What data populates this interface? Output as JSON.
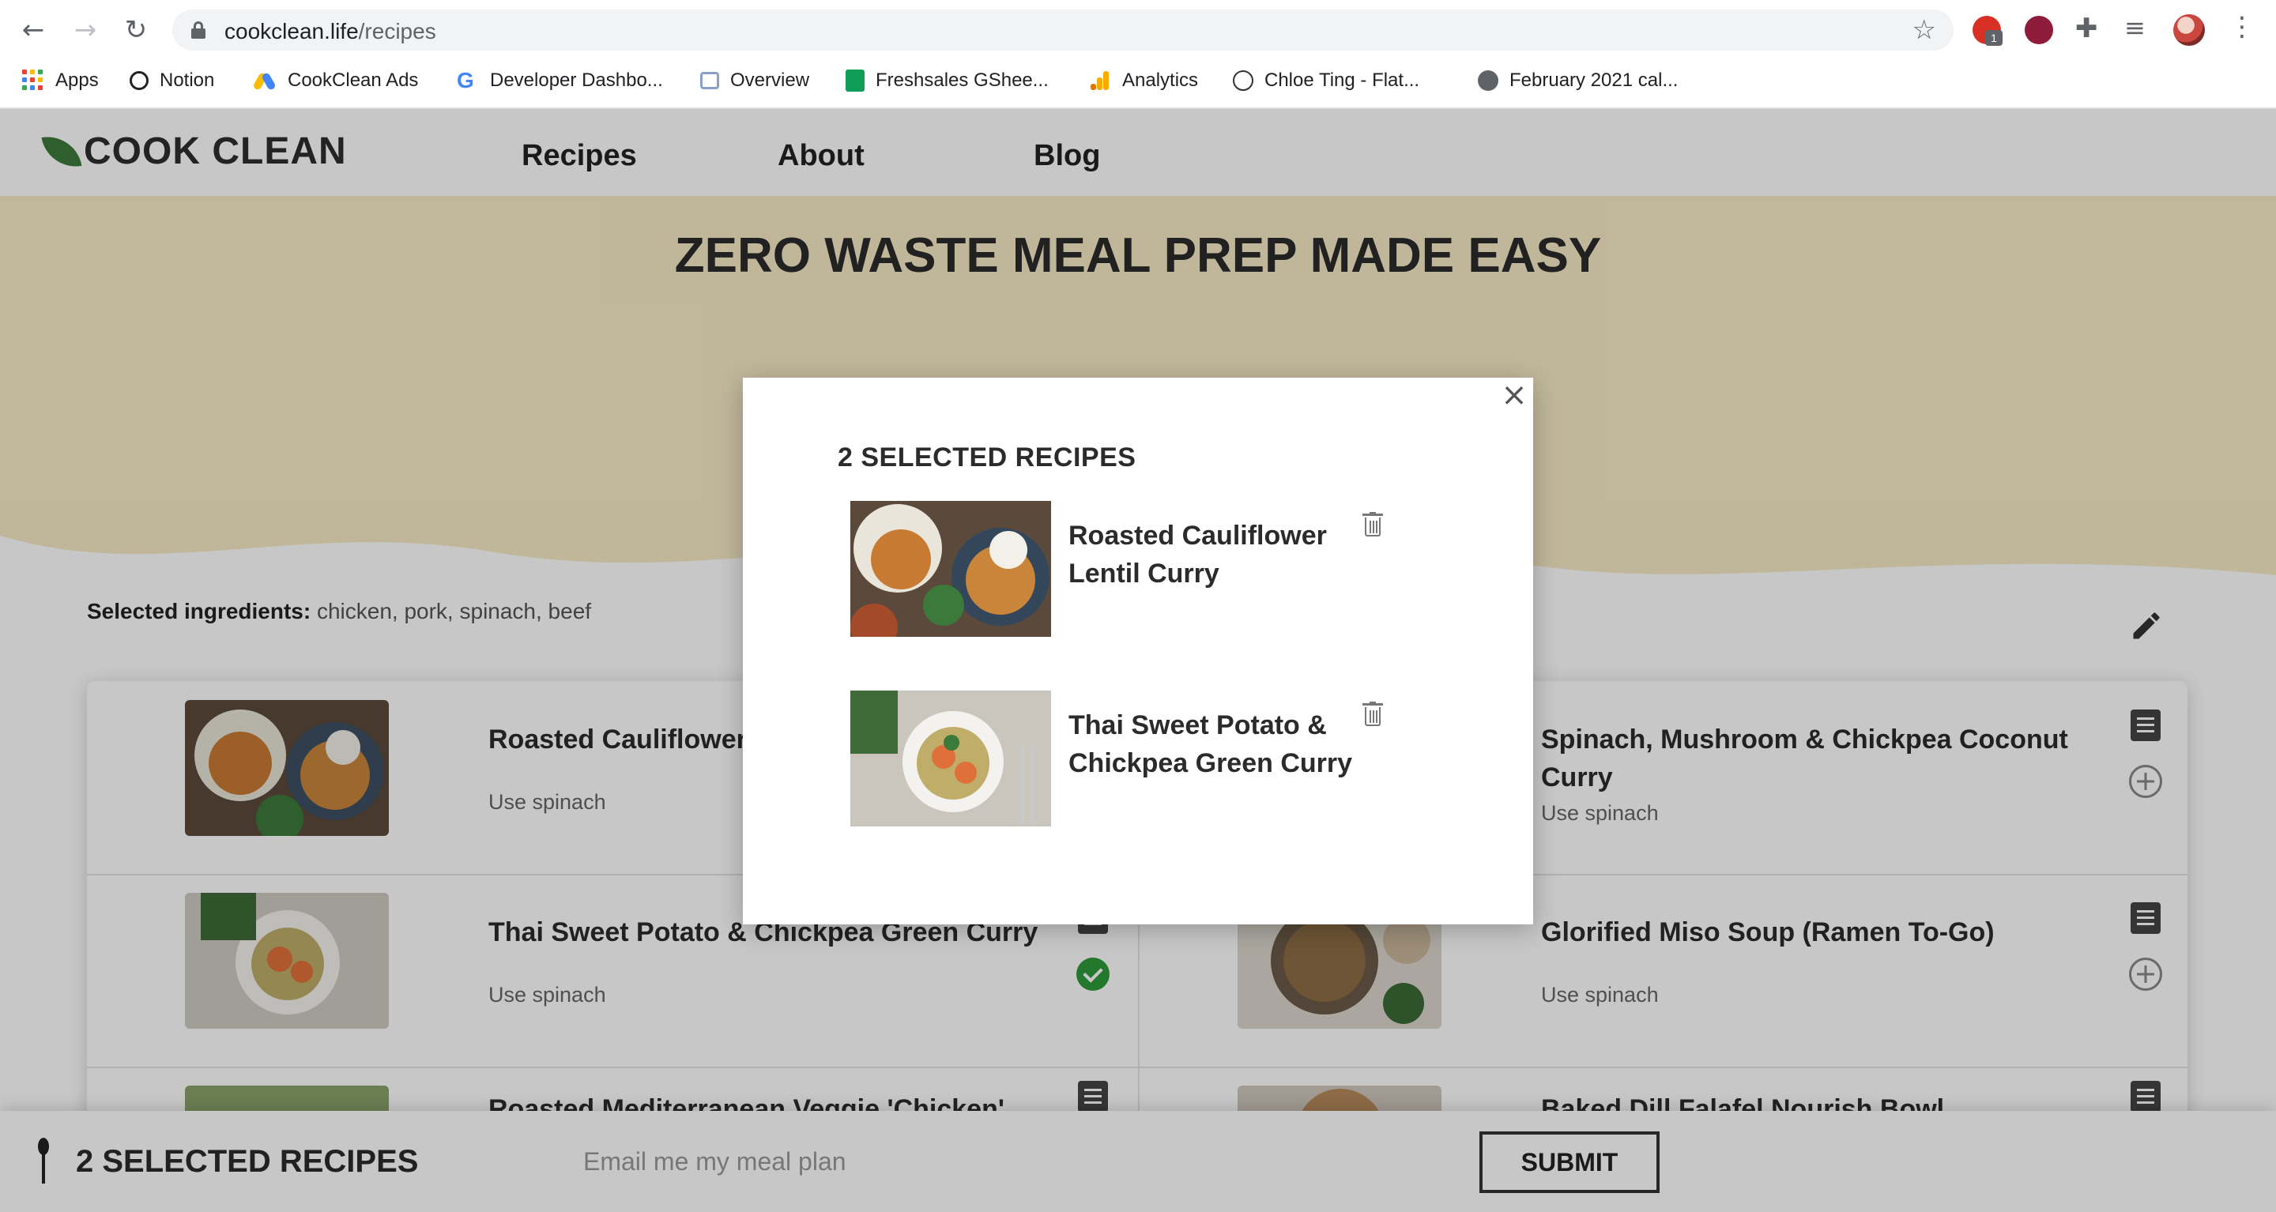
{
  "browser": {
    "url_domain": "cookclean.life",
    "url_path": "/recipes",
    "extension_badge": "1",
    "bookmarks": [
      {
        "label": "Apps",
        "icon": "apps-icon"
      },
      {
        "label": "Notion",
        "icon": "notion-icon"
      },
      {
        "label": "CookClean Ads",
        "icon": "google-ads-icon"
      },
      {
        "label": "Developer Dashbo...",
        "icon": "google-icon"
      },
      {
        "label": "Overview",
        "icon": "overview-icon"
      },
      {
        "label": "Freshsales GShee...",
        "icon": "sheets-icon"
      },
      {
        "label": "Analytics",
        "icon": "analytics-icon"
      },
      {
        "label": "Chloe Ting - Flat...",
        "icon": "chloe-ting-icon"
      },
      {
        "label": "February 2021 cal...",
        "icon": "globe-icon"
      }
    ]
  },
  "site": {
    "logo_text": "COOK CLEAN",
    "nav": [
      "Recipes",
      "About",
      "Blog"
    ],
    "hero_title": "ZERO WASTE MEAL PREP MADE EASY",
    "selected_ingredients_label": "Selected ingredients:",
    "selected_ingredients_value": "chicken, pork, spinach, beef",
    "recipes": [
      {
        "title": "Roasted Cauliflower Lentil Curry",
        "subtitle": "Use spinach",
        "selected": false
      },
      {
        "title": "Spinach, Mushroom & Chickpea Coconut Curry",
        "subtitle": "Use spinach",
        "selected": false
      },
      {
        "title": "Thai Sweet Potato & Chickpea Green Curry",
        "subtitle": "Use spinach",
        "selected": true
      },
      {
        "title": "Glorified Miso Soup (Ramen To-Go)",
        "subtitle": "Use spinach",
        "selected": false
      },
      {
        "title": "Roasted Mediterranean Veggie 'Chicken'",
        "subtitle": "",
        "selected": false
      },
      {
        "title": "Baked Dill Falafel Nourish Bowl",
        "subtitle": "",
        "selected": false
      }
    ]
  },
  "bottom_bar": {
    "count_label": "2 SELECTED RECIPES",
    "email_placeholder": "Email me my meal plan",
    "submit_label": "SUBMIT"
  },
  "modal": {
    "close_glyph": "×",
    "title": "2 SELECTED RECIPES",
    "items": [
      {
        "title": "Roasted Cauliflower Lentil Curry"
      },
      {
        "title": "Thai Sweet Potato & Chickpea Green Curry"
      }
    ]
  },
  "colors": {
    "brand_green": "#3d7a3a",
    "hero_background": "#f7ebc7",
    "selected_check": "#2f9a3a"
  }
}
